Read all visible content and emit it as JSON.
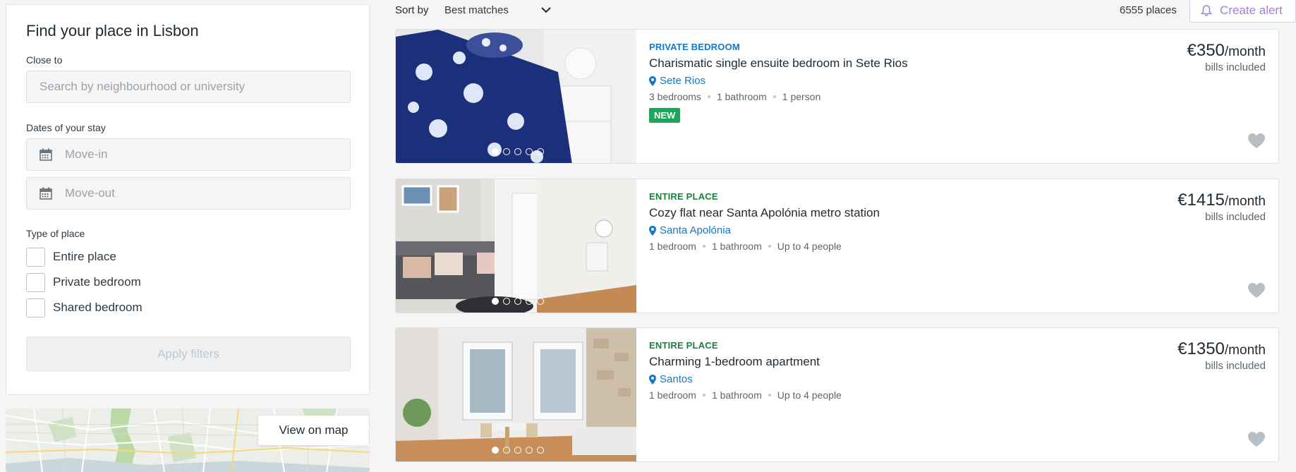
{
  "filters": {
    "title": "Find your place in Lisbon",
    "close_to_label": "Close to",
    "search_placeholder": "Search by neighbourhood or university",
    "dates_label": "Dates of your stay",
    "move_in_placeholder": "Move-in",
    "move_out_placeholder": "Move-out",
    "type_label": "Type of place",
    "types": [
      {
        "label": "Entire place",
        "checked": false
      },
      {
        "label": "Private bedroom",
        "checked": false
      },
      {
        "label": "Shared bedroom",
        "checked": false
      }
    ],
    "apply_label": "Apply filters"
  },
  "map": {
    "button_label": "View on map"
  },
  "topbar": {
    "sort_label": "Sort by",
    "sort_value": "Best matches",
    "count": "6555 places",
    "alert_label": "Create alert"
  },
  "listings": [
    {
      "type": "PRIVATE BEDROOM",
      "title": "Charismatic single ensuite bedroom in Sete Rios",
      "location": "Sete Rios",
      "bedrooms": "3 bedrooms",
      "bathrooms": "1 bathroom",
      "people": "1 person",
      "badge": "NEW",
      "price": "€350",
      "period": "/month",
      "bills": "bills included",
      "active_photo": 1,
      "photo_count": 5
    },
    {
      "type": "ENTIRE PLACE",
      "title": "Cozy flat near Santa Apolónia metro station",
      "location": "Santa Apolónia",
      "bedrooms": "1 bedroom",
      "bathrooms": "1 bathroom",
      "people": "Up to 4 people",
      "badge": "",
      "price": "€1415",
      "period": "/month",
      "bills": "bills included",
      "active_photo": 1,
      "photo_count": 5
    },
    {
      "type": "ENTIRE PLACE",
      "title": "Charming 1-bedroom apartment",
      "location": "Santos",
      "bedrooms": "1 bedroom",
      "bathrooms": "1 bathroom",
      "people": "Up to 4 people",
      "badge": "",
      "price": "€1350",
      "period": "/month",
      "bills": "bills included",
      "active_photo": 1,
      "photo_count": 5
    }
  ],
  "icons": {
    "calendar": "calendar-icon",
    "pin": "map-pin-icon",
    "heart": "heart-icon",
    "bell": "bell-icon",
    "chevron": "chevron-down-icon"
  },
  "colors": {
    "private_type": "#1478c8",
    "entire_type": "#1b7f3f",
    "new_badge": "#1ea75a",
    "alert_accent": "#a67ddc",
    "location_link": "#1478c8"
  }
}
